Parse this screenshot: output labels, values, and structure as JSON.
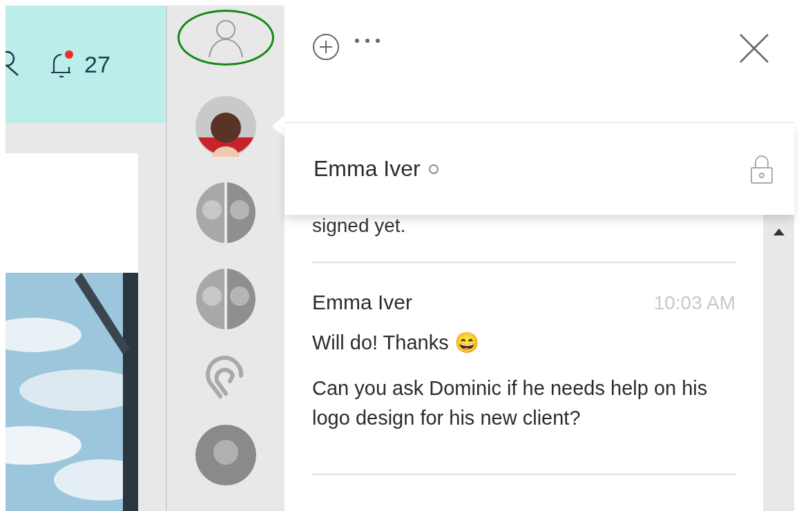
{
  "top_bar": {
    "notification_count": "27",
    "unread": true
  },
  "sidebar": {
    "me": {
      "highlighted": true
    },
    "conversations": [
      {
        "kind": "person",
        "selected": true
      },
      {
        "kind": "group",
        "selected": false
      },
      {
        "kind": "group",
        "selected": false
      },
      {
        "kind": "channel",
        "selected": false
      },
      {
        "kind": "person_grey",
        "selected": false
      }
    ]
  },
  "chat": {
    "contact": {
      "name": "Emma Iver",
      "online": false,
      "locked": true
    },
    "earlier_text": "signed yet.",
    "messages": [
      {
        "author": "Emma Iver",
        "time": "10:03 AM",
        "lines": [
          "Will do! Thanks 😄",
          "Can you ask Dominic if he needs help on his logo design for his new client?"
        ]
      }
    ]
  }
}
